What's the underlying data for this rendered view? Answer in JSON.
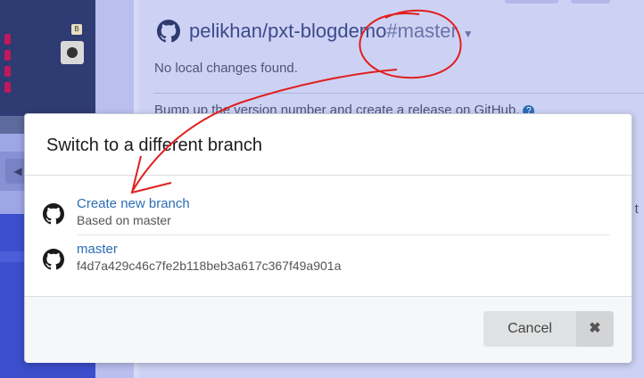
{
  "repo": {
    "name": "pelikhan/pxt-blogdemo",
    "branch_tag": "#master",
    "caret_icon": "caret-down-icon"
  },
  "status": {
    "no_changes": "No local changes found.",
    "bump_text": "Bump up the version number and create a release on GitHub.",
    "truncated_right_text": "s t"
  },
  "simulator": {
    "btn_b_label": "B",
    "sound_icon": "speaker-icon"
  },
  "dialog": {
    "title": "Switch to a different branch",
    "items": [
      {
        "title": "Create new branch",
        "subtitle": "Based on master",
        "icon": "github-icon"
      },
      {
        "title": "master",
        "subtitle": "f4d7a429c46c7fe2b118beb3a617c367f49a901a",
        "icon": "github-icon"
      }
    ],
    "cancel_label": "Cancel",
    "close_icon": "close-icon"
  },
  "colors": {
    "accent_link": "#2c6db5",
    "annotation": "#e0201e",
    "overlay_blue": "#cdd2f4"
  }
}
